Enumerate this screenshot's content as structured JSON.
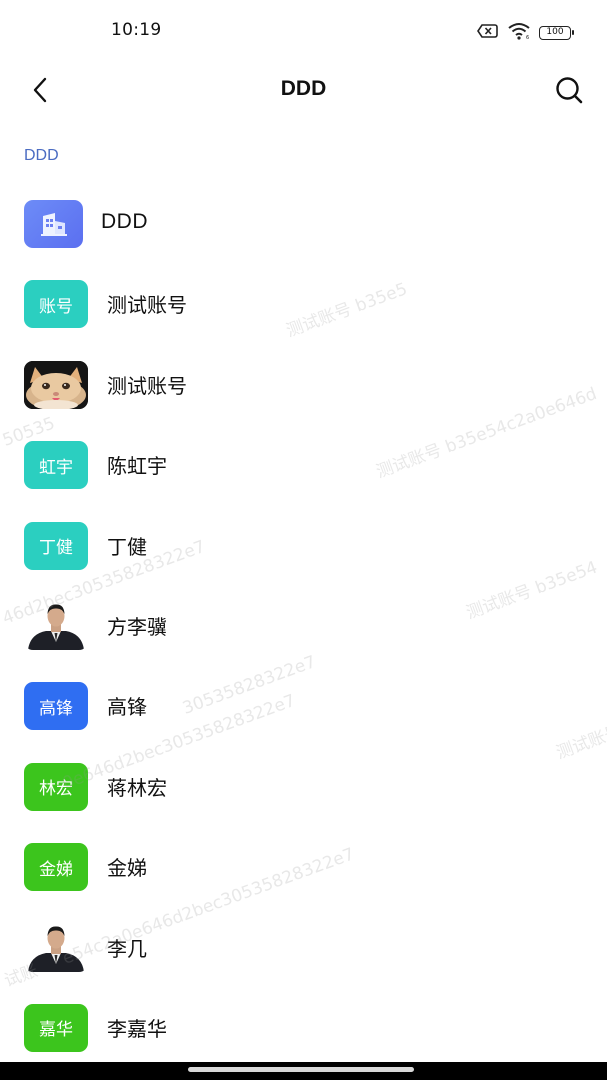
{
  "status_bar": {
    "time": "10:19",
    "battery": "100",
    "icons": [
      "sim-off-icon",
      "wifi-icon",
      "battery-icon"
    ]
  },
  "nav": {
    "title": "DDD",
    "back_icon": "chevron-left-icon",
    "search_icon": "search-icon"
  },
  "breadcrumb": "DDD",
  "list": [
    {
      "type": "org",
      "name": "DDD",
      "avatar_kind": "building-icon"
    },
    {
      "type": "member",
      "name": "测试账号",
      "avatar_text": "账号",
      "avatar_color": "#2bcfc0"
    },
    {
      "type": "member",
      "name": "测试账号",
      "avatar_kind": "photo-cat"
    },
    {
      "type": "member",
      "name": "陈虹宇",
      "avatar_text": "虹宇",
      "avatar_color": "#2bcfc0"
    },
    {
      "type": "member",
      "name": "丁健",
      "avatar_text": "丁健",
      "avatar_color": "#2bcfc0"
    },
    {
      "type": "member",
      "name": "方李骥",
      "avatar_kind": "photo-person"
    },
    {
      "type": "member",
      "name": "高锋",
      "avatar_text": "高锋",
      "avatar_color": "#2f6ef2"
    },
    {
      "type": "member",
      "name": "蒋林宏",
      "avatar_text": "林宏",
      "avatar_color": "#3cc51d"
    },
    {
      "type": "member",
      "name": "金娣",
      "avatar_text": "金娣",
      "avatar_color": "#3cc51d"
    },
    {
      "type": "member",
      "name": "李几",
      "avatar_kind": "photo-person"
    },
    {
      "type": "member",
      "name": "李嘉华",
      "avatar_text": "嘉华",
      "avatar_color": "#3cc51d"
    }
  ],
  "watermark": {
    "texts": [
      "测试账号 b35e5",
      "测试账号 b35e54c2a0e646d",
      "测试账号 b35e54",
      "测试账号",
      "e54c2a0e646d2bec30535828322e7",
      "46d2bec30535828322e7",
      "0e646d2bec30535828322e7",
      "30535828322e7",
      "50535",
      "试账"
    ]
  }
}
